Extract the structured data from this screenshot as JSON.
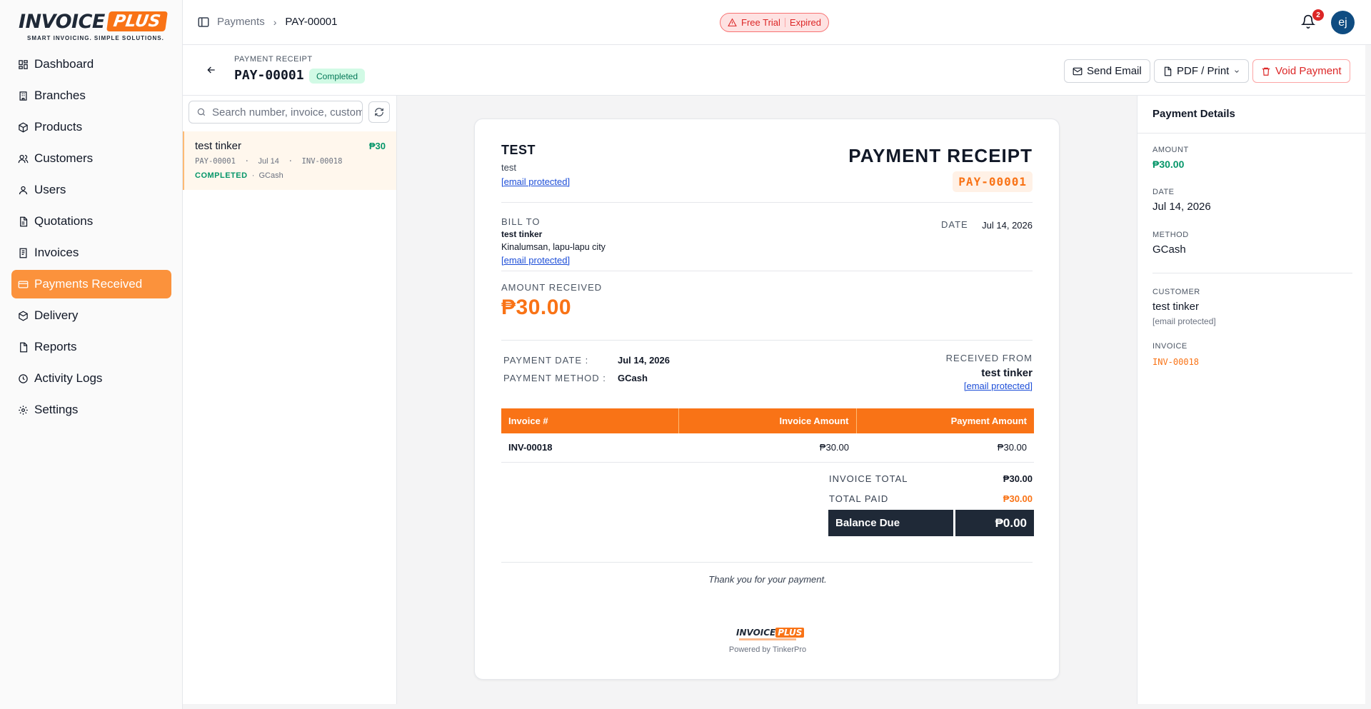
{
  "brand": {
    "logo_word": "INVOICE",
    "logo_plus": "PLUS",
    "tagline": "SMART INVOICING. SIMPLE SOLUTIONS.",
    "accent": "#f97316"
  },
  "sidebar": {
    "items": [
      {
        "label": "Dashboard",
        "icon": "dashboard-icon"
      },
      {
        "label": "Branches",
        "icon": "building-icon"
      },
      {
        "label": "Products",
        "icon": "package-icon"
      },
      {
        "label": "Customers",
        "icon": "customers-icon"
      },
      {
        "label": "Users",
        "icon": "user-icon"
      },
      {
        "label": "Quotations",
        "icon": "document-icon"
      },
      {
        "label": "Invoices",
        "icon": "invoice-icon"
      },
      {
        "label": "Payments Received",
        "icon": "card-icon",
        "active": true
      },
      {
        "label": "Delivery",
        "icon": "truck-icon"
      },
      {
        "label": "Reports",
        "icon": "report-icon"
      },
      {
        "label": "Activity Logs",
        "icon": "clock-icon"
      },
      {
        "label": "Settings",
        "icon": "gear-icon"
      }
    ]
  },
  "topbar": {
    "breadcrumb_parent": "Payments",
    "breadcrumb_current": "PAY-00001",
    "trial_label": "Free Trial",
    "trial_status": "Expired",
    "notification_count": "2",
    "avatar_initials": "ej"
  },
  "header": {
    "kicker": "PAYMENT RECEIPT",
    "number": "PAY-00001",
    "status": "Completed",
    "send_email": "Send Email",
    "pdf_print": "PDF / Print",
    "void": "Void Payment"
  },
  "list": {
    "search_placeholder": "Search number, invoice, customer...",
    "items": [
      {
        "name": "test tinker",
        "amount": "₱30",
        "number": "PAY-00001",
        "sep": "·",
        "date": "Jul 14",
        "invoice": "INV-00018",
        "status": "COMPLETED",
        "method": "GCash"
      }
    ]
  },
  "receipt": {
    "company": "TEST",
    "company_sub": "test",
    "company_email": "[email protected]",
    "title": "PAYMENT RECEIPT",
    "number": "PAY-00001",
    "bill_to_label": "BILL TO",
    "bill_name": "test tinker",
    "bill_address": "Kinalumsan, lapu-lapu city",
    "bill_email": "[email protected]",
    "date_label": "DATE",
    "date_value": "Jul 14, 2026",
    "amount_label": "AMOUNT RECEIVED",
    "amount": "₱30.00",
    "payment_date_label": "PAYMENT DATE :",
    "payment_date": "Jul 14, 2026",
    "payment_method_label": "PAYMENT METHOD :",
    "payment_method": "GCash",
    "received_from_label": "RECEIVED FROM",
    "received_from_name": "test tinker",
    "received_from_email": "[email protected]",
    "table": {
      "headers": [
        "Invoice #",
        "Invoice Amount",
        "Payment Amount"
      ],
      "rows": [
        [
          "INV-00018",
          "₱30.00",
          "₱30.00"
        ]
      ]
    },
    "invoice_total_label": "INVOICE TOTAL",
    "invoice_total": "₱30.00",
    "total_paid_label": "TOTAL PAID",
    "total_paid": "₱30.00",
    "balance_label": "Balance Due",
    "balance": "₱0.00",
    "thanks": "Thank you for your payment.",
    "powered": "Powered by TinkerPro"
  },
  "details": {
    "title": "Payment Details",
    "amount_label": "AMOUNT",
    "amount": "₱30.00",
    "date_label": "DATE",
    "date": "Jul 14, 2026",
    "method_label": "METHOD",
    "method": "GCash",
    "customer_label": "CUSTOMER",
    "customer_name": "test tinker",
    "customer_email": "[email protected]",
    "invoice_label": "INVOICE",
    "invoice": "INV-00018"
  }
}
